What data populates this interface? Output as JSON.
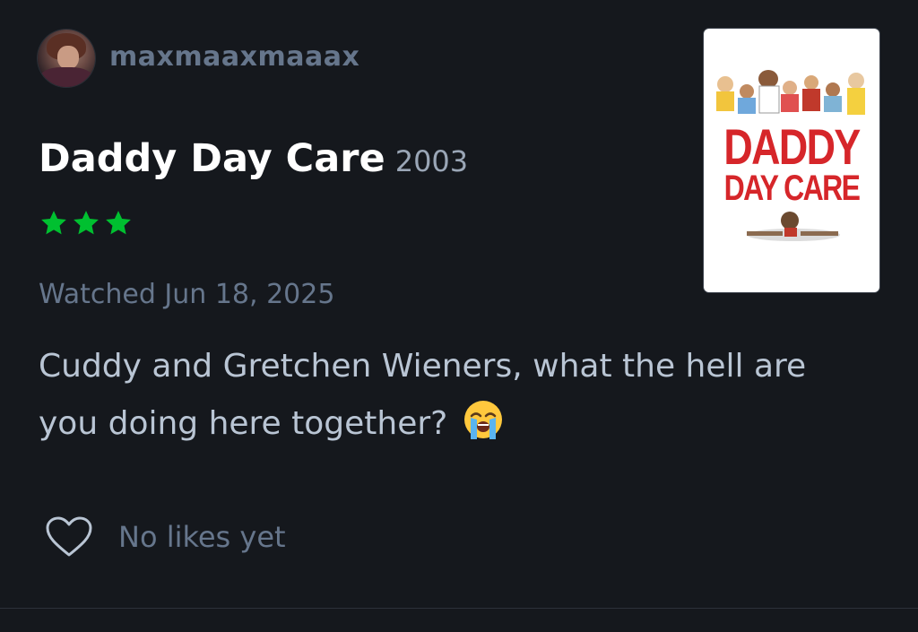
{
  "review": {
    "username": "maxmaaxmaaax",
    "film_title": "Daddy Day Care",
    "film_year": "2003",
    "rating_stars": 3,
    "watched_text": "Watched Jun 18, 2025",
    "body": "Cuddy and Gretchen Wieners, what the hell are you doing here together?",
    "emoji_icon": "loudly-crying-face-icon"
  },
  "poster": {
    "title_line1": "DADDY",
    "title_line2": "DAY CARE"
  },
  "likes": {
    "text": "No likes yet"
  },
  "colors": {
    "background": "#15181d",
    "star_green": "#00c030",
    "muted_text": "#66768c",
    "review_text": "#b9c5d4",
    "poster_red": "#d6262a"
  }
}
